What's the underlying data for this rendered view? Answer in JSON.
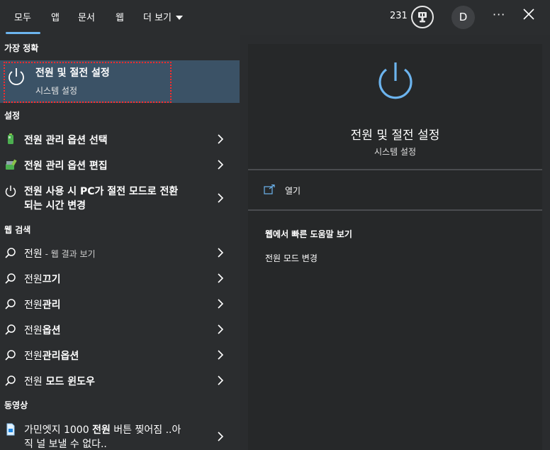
{
  "tabs": [
    {
      "label": "모두",
      "active": true
    },
    {
      "label": "앱"
    },
    {
      "label": "문서"
    },
    {
      "label": "웹"
    },
    {
      "label": "더 보기"
    }
  ],
  "header": {
    "points": "231",
    "avatar_letter": "D",
    "more_label": "···"
  },
  "best_match": {
    "section": "가장 정확",
    "title": "전원 및 절전 설정",
    "subtitle": "시스템 설정"
  },
  "settings": {
    "section": "설정",
    "items": [
      {
        "label": "전원 관리 옵션 선택"
      },
      {
        "label": "전원 관리 옵션 편집"
      },
      {
        "label_line1": "전원 사용 시 PC가 절전 모드로 전환",
        "label_line2": "되는 시간 변경"
      }
    ]
  },
  "web_search": {
    "section": "웹 검색",
    "items": [
      {
        "prefix": "전원",
        "suffix": " - 웹 결과 보기"
      },
      {
        "prefix": "전원",
        "bold": "끄기"
      },
      {
        "prefix": "전원",
        "bold": "관리"
      },
      {
        "prefix": "전원",
        "bold": "옵션"
      },
      {
        "prefix": "전원",
        "bold": "관리옵션"
      },
      {
        "prefix": "전원",
        "bold": " 모드 윈도우"
      }
    ]
  },
  "videos": {
    "section": "동영상",
    "items": [
      {
        "line1_a": "가민엣지 1000 ",
        "line1_b": "전원",
        "line1_c": " 버튼 찢어짐 ..아",
        "line2": "직 널 보낼 수 없다.."
      }
    ]
  },
  "preview": {
    "title": "전원 및 절전 설정",
    "subtitle": "시스템 설정",
    "open_label": "열기",
    "help_title": "웹에서 빠른 도움말 보기",
    "help_link": "전원 모드 변경"
  },
  "colors": {
    "accent": "#6cb4ee",
    "selected_bg": "#3b5266",
    "highlight_border": "#ff2b2b"
  }
}
